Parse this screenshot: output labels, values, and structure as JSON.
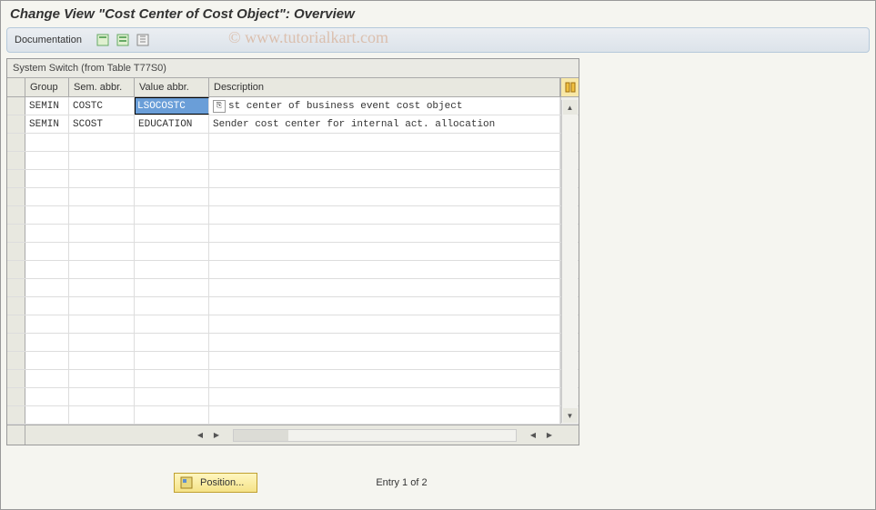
{
  "title": "Change View \"Cost Center of Cost Object\": Overview",
  "toolbar": {
    "documentation": "Documentation"
  },
  "table": {
    "title": "System Switch (from Table T77S0)",
    "columns": {
      "group": "Group",
      "sem": "Sem. abbr.",
      "value": "Value abbr.",
      "desc": "Description"
    },
    "rows": [
      {
        "group": "SEMIN",
        "sem": "COSTC",
        "value": "LSOCOSTC",
        "desc": "st center of business event cost object",
        "selected_value": true
      },
      {
        "group": "SEMIN",
        "sem": "SCOST",
        "value": "EDUCATION",
        "desc": "Sender cost center for internal act. allocation"
      }
    ]
  },
  "footer": {
    "position_label": "Position...",
    "entry_text": "Entry 1 of 2"
  },
  "watermark": "© www.tutorialkart.com"
}
